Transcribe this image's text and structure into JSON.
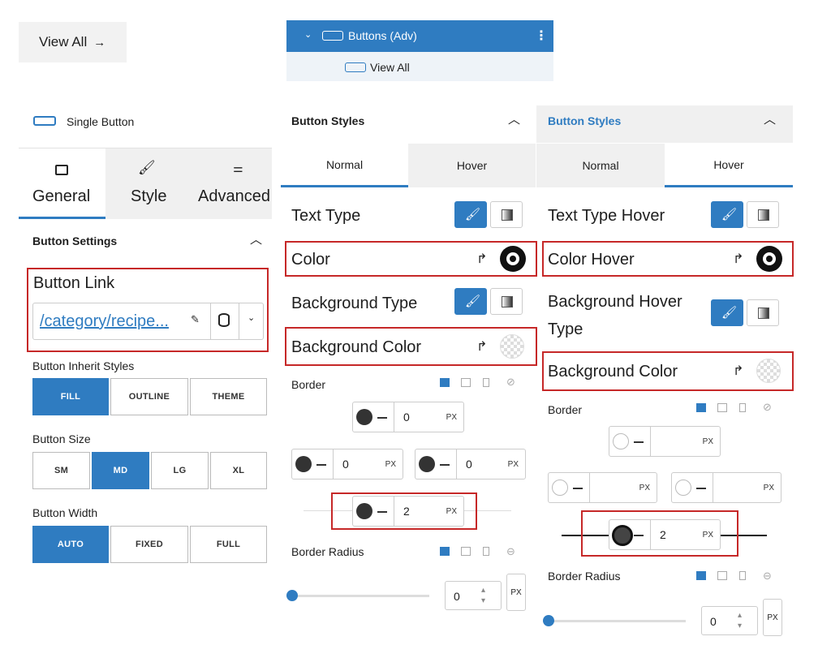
{
  "view_all_button": {
    "label": "View All",
    "arrow": "→"
  },
  "tree": {
    "parent": "Buttons (Adv)",
    "child": "View All"
  },
  "left_panel": {
    "block_title": "Single Button",
    "tabs": [
      {
        "label": "General"
      },
      {
        "label": "Style"
      },
      {
        "label": "Advanced"
      }
    ],
    "section_title": "Button Settings",
    "button_link_label": "Button Link",
    "button_link_value": "/category/recipe...",
    "inherit_label": "Button Inherit Styles",
    "inherit_options": [
      "FILL",
      "OUTLINE",
      "THEME"
    ],
    "size_label": "Button Size",
    "size_options": [
      "SM",
      "MD",
      "LG",
      "XL"
    ],
    "width_label": "Button Width",
    "width_options": [
      "AUTO",
      "FIXED",
      "FULL"
    ]
  },
  "middle_panel": {
    "section_title": "Button Styles",
    "tabs": [
      "Normal",
      "Hover"
    ],
    "text_type": "Text Type",
    "color": "Color",
    "background_type": "Background Type",
    "background_color": "Background Color",
    "border": "Border",
    "border_top": "0",
    "border_left": "0",
    "border_right": "0",
    "border_bottom": "2",
    "unit": "PX",
    "border_radius": "Border Radius",
    "radius_value": "0"
  },
  "right_panel": {
    "section_title": "Button Styles",
    "tabs": [
      "Normal",
      "Hover"
    ],
    "text_type": "Text Type Hover",
    "color": "Color Hover",
    "background_type_1": "Background Hover",
    "background_type_2": "Type",
    "background_color": "Background Color",
    "border": "Border",
    "border_bottom": "2",
    "unit": "PX",
    "border_radius": "Border Radius",
    "radius_value": "0"
  },
  "colors": {
    "accent": "#2f7cc1",
    "highlight": "#c62828"
  }
}
